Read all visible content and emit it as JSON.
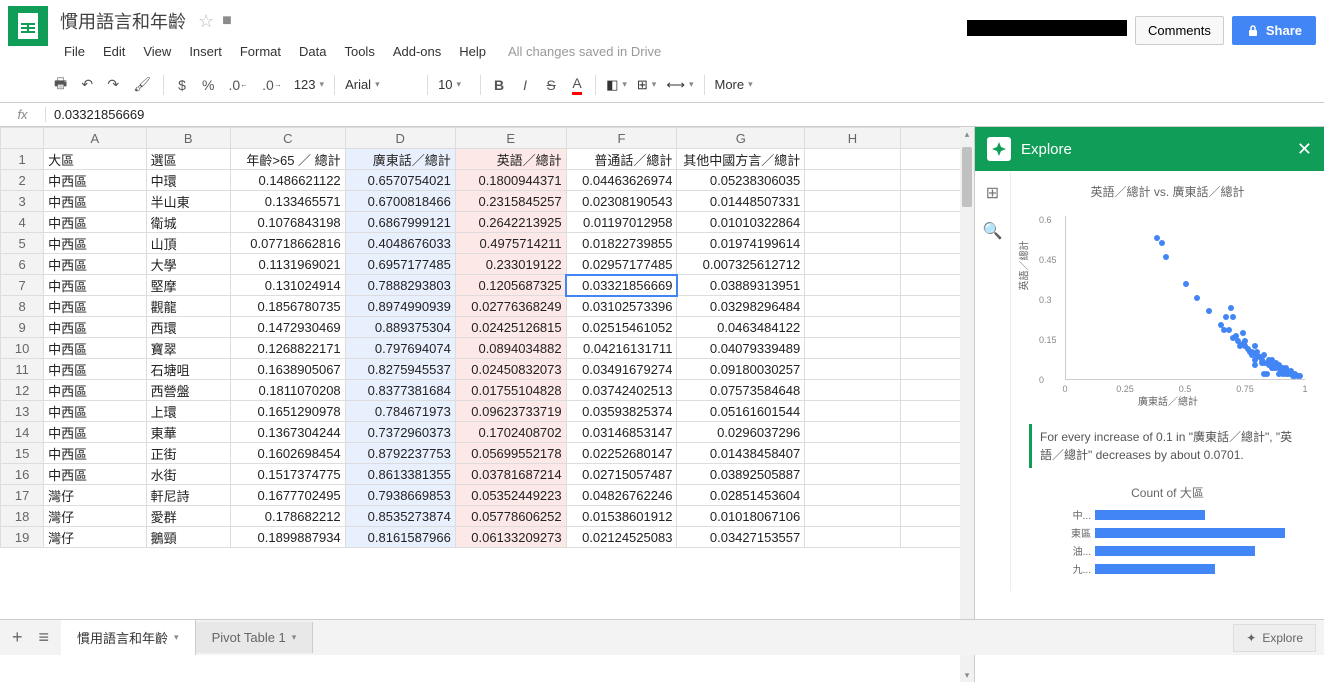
{
  "doc": {
    "title": "慣用語言和年齡",
    "save_status": "All changes saved in Drive"
  },
  "menu": {
    "file": "File",
    "edit": "Edit",
    "view": "View",
    "insert": "Insert",
    "format": "Format",
    "data": "Data",
    "tools": "Tools",
    "addons": "Add-ons",
    "help": "Help"
  },
  "header_buttons": {
    "comments": "Comments",
    "share": "Share"
  },
  "toolbar": {
    "currency": "$",
    "percent": "%",
    "dec_dec": ".0",
    "dec_inc": ".00",
    "numfmt": "123",
    "font": "Arial",
    "size": "10",
    "more": "More"
  },
  "formula": {
    "fx": "fx",
    "value": "0.03321856669"
  },
  "columns": [
    "A",
    "B",
    "C",
    "D",
    "E",
    "F",
    "G",
    "H",
    ""
  ],
  "headers_row": [
    "大區",
    "選區",
    "年齡>65 ／ 總計",
    "廣東話／總計",
    "英語／總計",
    "普通話／總計",
    "其他中國方言／總計",
    "",
    ""
  ],
  "active": {
    "row": 7,
    "col": 5
  },
  "rows": [
    [
      "中西區",
      "中環",
      "0.1486621122",
      "0.6570754021",
      "0.1800944371",
      "0.04463626974",
      "0.05238306035",
      "",
      ""
    ],
    [
      "中西區",
      "半山東",
      "0.133465571",
      "0.6700818466",
      "0.2315845257",
      "0.02308190543",
      "0.01448507331",
      "",
      ""
    ],
    [
      "中西區",
      "衛城",
      "0.1076843198",
      "0.6867999121",
      "0.2642213925",
      "0.01197012958",
      "0.01010322864",
      "",
      ""
    ],
    [
      "中西區",
      "山頂",
      "0.07718662816",
      "0.4048676033",
      "0.4975714211",
      "0.01822739855",
      "0.01974199614",
      "",
      ""
    ],
    [
      "中西區",
      "大學",
      "0.1131969021",
      "0.6957177485",
      "0.233019122",
      "0.02957177485",
      "0.007325612712",
      "",
      ""
    ],
    [
      "中西區",
      "堅摩",
      "0.131024914",
      "0.7888293803",
      "0.1205687325",
      "0.03321856669",
      "0.03889313951",
      "",
      ""
    ],
    [
      "中西區",
      "觀龍",
      "0.1856780735",
      "0.8974990939",
      "0.02776368249",
      "0.03102573396",
      "0.03298296484",
      "",
      ""
    ],
    [
      "中西區",
      "西環",
      "0.1472930469",
      "0.889375304",
      "0.02425126815",
      "0.02515461052",
      "0.0463484122",
      "",
      ""
    ],
    [
      "中西區",
      "寶翠",
      "0.1268822171",
      "0.797694074",
      "0.0894034882",
      "0.04216131711",
      "0.04079339489",
      "",
      ""
    ],
    [
      "中西區",
      "石塘咀",
      "0.1638905067",
      "0.8275945537",
      "0.02450832073",
      "0.03491679274",
      "0.09180030257",
      "",
      ""
    ],
    [
      "中西區",
      "西營盤",
      "0.1811070208",
      "0.8377381684",
      "0.01755104828",
      "0.03742402513",
      "0.07573584648",
      "",
      ""
    ],
    [
      "中西區",
      "上環",
      "0.1651290978",
      "0.784671973",
      "0.09623733719",
      "0.03593825374",
      "0.05161601544",
      "",
      ""
    ],
    [
      "中西區",
      "東華",
      "0.1367304244",
      "0.7372960373",
      "0.1702408702",
      "0.03146853147",
      "0.0296037296",
      "",
      ""
    ],
    [
      "中西區",
      "正街",
      "0.1602698454",
      "0.8792237753",
      "0.05699552178",
      "0.02252680147",
      "0.01438458407",
      "",
      ""
    ],
    [
      "中西區",
      "水街",
      "0.1517374775",
      "0.8613381355",
      "0.03781687214",
      "0.02715057487",
      "0.03892505887",
      "",
      ""
    ],
    [
      "灣仔",
      "軒尼詩",
      "0.1677702495",
      "0.7938669853",
      "0.05352449223",
      "0.04826762246",
      "0.02851453604",
      "",
      ""
    ],
    [
      "灣仔",
      "愛群",
      "0.178682212",
      "0.8535273874",
      "0.05778606252",
      "0.01538601912",
      "0.01018067106",
      "",
      ""
    ],
    [
      "灣仔",
      "鵝頸",
      "0.1899887934",
      "0.8161587966",
      "0.06133209273",
      "0.02124525083",
      "0.03427153557",
      "",
      ""
    ]
  ],
  "explore": {
    "title": "Explore",
    "scatter_title": "英語／總計 vs. 廣東話／總計",
    "xlabel": "廣東話／總計",
    "ylabel": "英語／總計",
    "insight": "For every increase of 0.1 in \"廣東話／總計\", \"英語／總計\" decreases by about 0.0701.",
    "bar_title": "Count of 大區",
    "bar_labels": [
      "中...",
      "東區",
      "油...",
      "九..."
    ],
    "bar_values": [
      0.55,
      0.95,
      0.8,
      0.6
    ]
  },
  "chart_data": {
    "type": "scatter",
    "title": "英語／總計 vs. 廣東話／總計",
    "xlabel": "廣東話／總計",
    "ylabel": "英語／總計",
    "xlim": [
      0,
      1
    ],
    "ylim": [
      0,
      0.6
    ],
    "x_ticks": [
      0,
      0.25,
      0.5,
      0.75,
      1
    ],
    "y_ticks": [
      0,
      0.15,
      0.3,
      0.45,
      0.6
    ],
    "series": [
      {
        "name": "districts",
        "points": [
          [
            0.66,
            0.18
          ],
          [
            0.67,
            0.23
          ],
          [
            0.69,
            0.26
          ],
          [
            0.4,
            0.5
          ],
          [
            0.7,
            0.23
          ],
          [
            0.79,
            0.12
          ],
          [
            0.9,
            0.03
          ],
          [
            0.89,
            0.02
          ],
          [
            0.8,
            0.09
          ],
          [
            0.38,
            0.52
          ],
          [
            0.42,
            0.45
          ],
          [
            0.83,
            0.02
          ],
          [
            0.84,
            0.02
          ],
          [
            0.78,
            0.1
          ],
          [
            0.74,
            0.17
          ],
          [
            0.88,
            0.06
          ],
          [
            0.86,
            0.04
          ],
          [
            0.79,
            0.05
          ],
          [
            0.85,
            0.06
          ],
          [
            0.82,
            0.06
          ],
          [
            0.92,
            0.02
          ],
          [
            0.91,
            0.03
          ],
          [
            0.93,
            0.02
          ],
          [
            0.94,
            0.02
          ],
          [
            0.95,
            0.01
          ],
          [
            0.88,
            0.05
          ],
          [
            0.9,
            0.04
          ],
          [
            0.85,
            0.07
          ],
          [
            0.87,
            0.05
          ],
          [
            0.89,
            0.04
          ],
          [
            0.75,
            0.12
          ],
          [
            0.77,
            0.1
          ],
          [
            0.8,
            0.08
          ],
          [
            0.82,
            0.07
          ],
          [
            0.84,
            0.06
          ],
          [
            0.86,
            0.05
          ],
          [
            0.91,
            0.02
          ],
          [
            0.93,
            0.03
          ],
          [
            0.95,
            0.02
          ],
          [
            0.96,
            0.01
          ],
          [
            0.97,
            0.01
          ],
          [
            0.72,
            0.14
          ],
          [
            0.74,
            0.13
          ],
          [
            0.76,
            0.11
          ],
          [
            0.78,
            0.09
          ],
          [
            0.81,
            0.08
          ],
          [
            0.83,
            0.06
          ],
          [
            0.87,
            0.04
          ],
          [
            0.9,
            0.03
          ],
          [
            0.92,
            0.03
          ],
          [
            0.94,
            0.02
          ],
          [
            0.7,
            0.15
          ],
          [
            0.73,
            0.12
          ],
          [
            0.79,
            0.07
          ],
          [
            0.85,
            0.05
          ],
          [
            0.88,
            0.04
          ],
          [
            0.91,
            0.04
          ],
          [
            0.68,
            0.18
          ],
          [
            0.71,
            0.16
          ],
          [
            0.75,
            0.14
          ],
          [
            0.8,
            0.1
          ],
          [
            0.83,
            0.09
          ],
          [
            0.86,
            0.07
          ],
          [
            0.89,
            0.05
          ],
          [
            0.92,
            0.04
          ],
          [
            0.94,
            0.03
          ],
          [
            0.96,
            0.02
          ],
          [
            0.98,
            0.01
          ],
          [
            0.65,
            0.2
          ],
          [
            0.5,
            0.35
          ],
          [
            0.55,
            0.3
          ],
          [
            0.6,
            0.25
          ]
        ]
      }
    ]
  },
  "tabs": {
    "tab1": "慣用語言和年齡",
    "tab2": "Pivot Table 1"
  },
  "footer": {
    "explore_btn": "Explore"
  }
}
